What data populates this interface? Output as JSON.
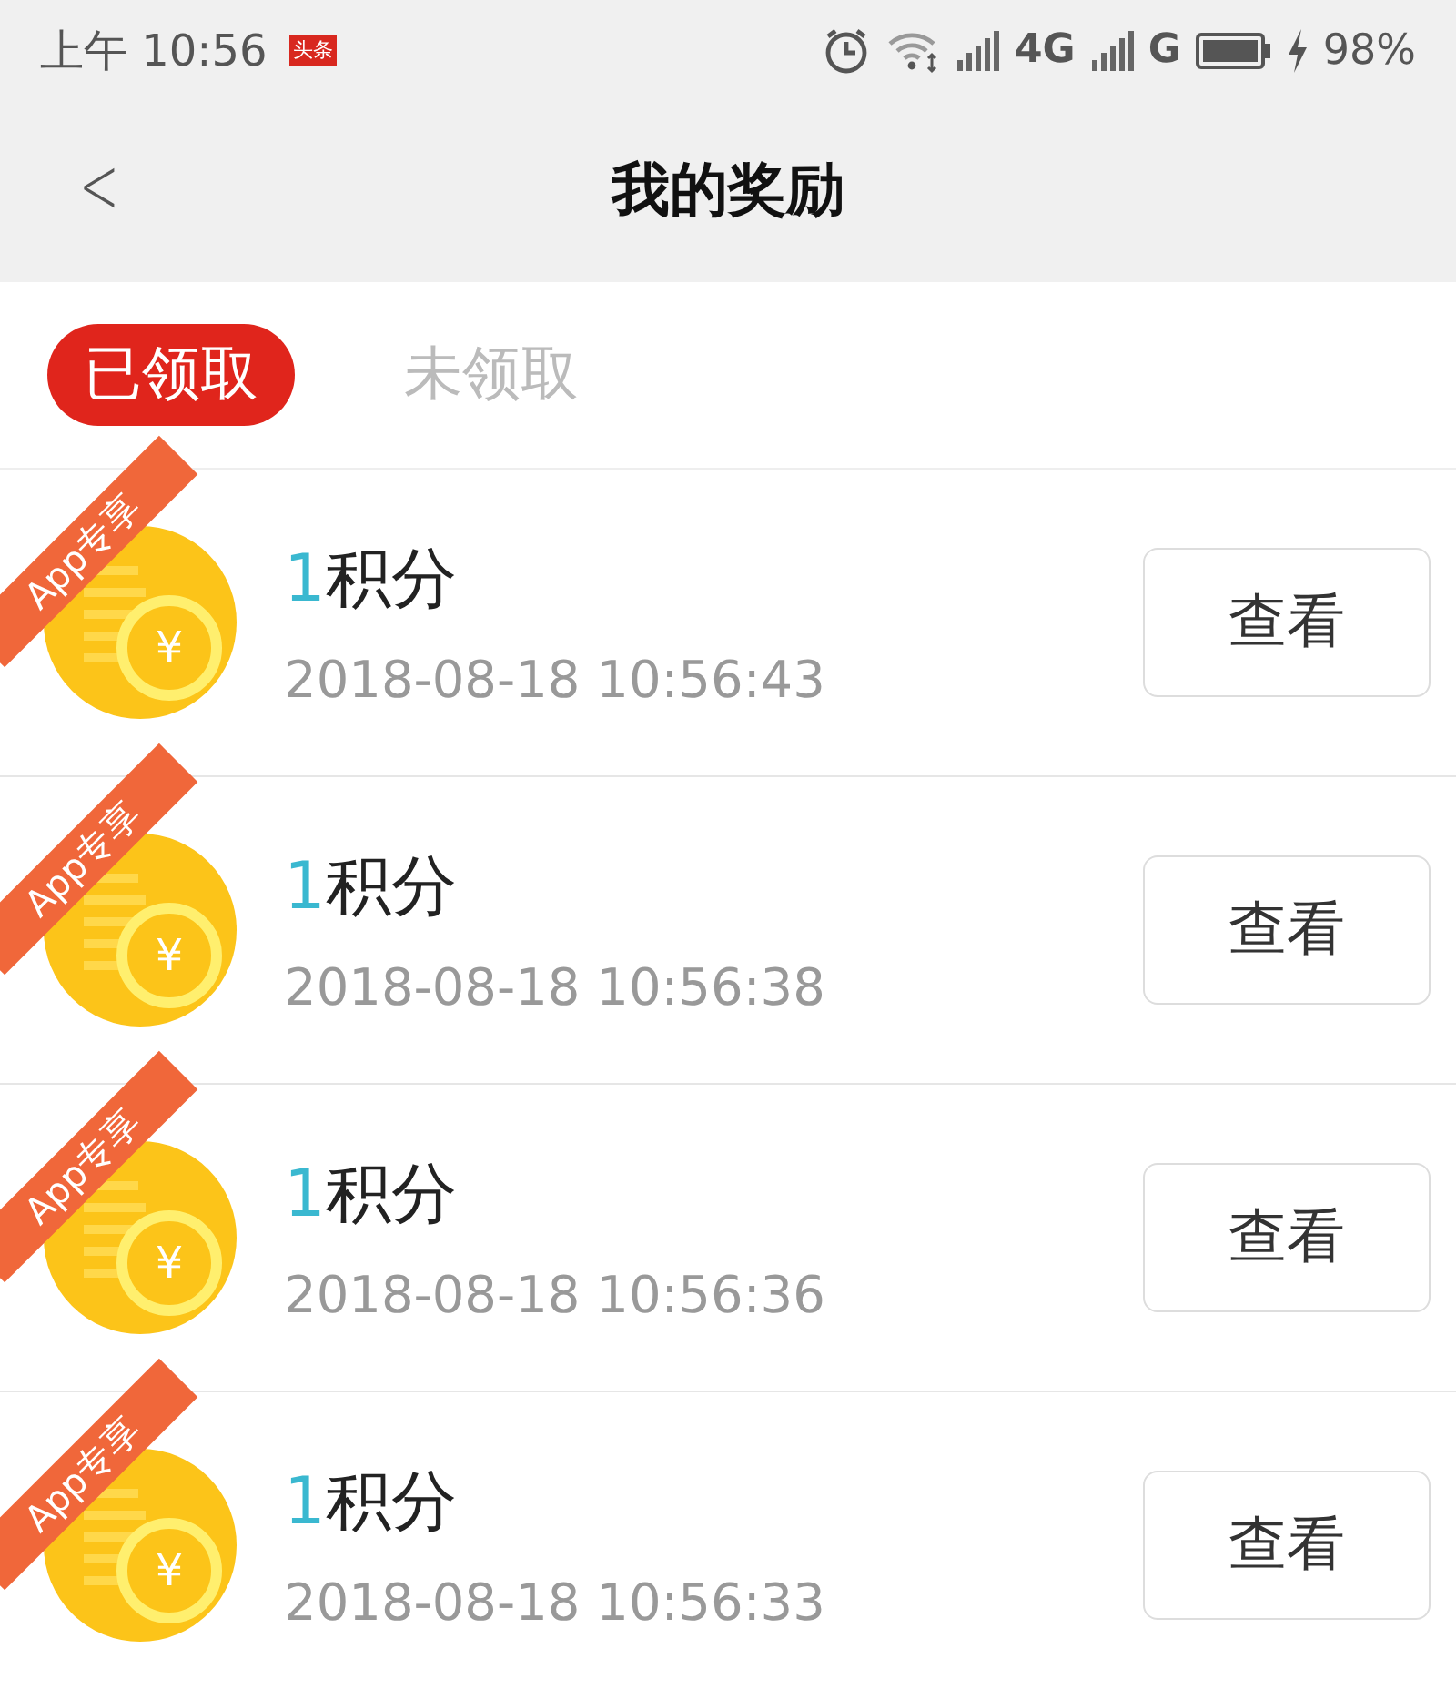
{
  "status_bar": {
    "time": "上午 10:56",
    "app_badge": "头条",
    "network_1": "4G",
    "network_2": "G",
    "battery": "98%"
  },
  "header": {
    "back": "<",
    "title": "我的奖励"
  },
  "tabs": [
    {
      "label": "已领取",
      "selected": true
    },
    {
      "label": "未领取",
      "selected": false
    }
  ],
  "rewards": [
    {
      "ribbon": "App专享",
      "coin_symbol": "¥",
      "amount": "1",
      "unit": "积分",
      "time": "2018-08-18 10:56:43",
      "button": "查看"
    },
    {
      "ribbon": "App专享",
      "coin_symbol": "¥",
      "amount": "1",
      "unit": "积分",
      "time": "2018-08-18 10:56:38",
      "button": "查看"
    },
    {
      "ribbon": "App专享",
      "coin_symbol": "¥",
      "amount": "1",
      "unit": "积分",
      "time": "2018-08-18 10:56:36",
      "button": "查看"
    },
    {
      "ribbon": "App专享",
      "coin_symbol": "¥",
      "amount": "1",
      "unit": "积分",
      "time": "2018-08-18 10:56:33",
      "button": "查看"
    }
  ]
}
